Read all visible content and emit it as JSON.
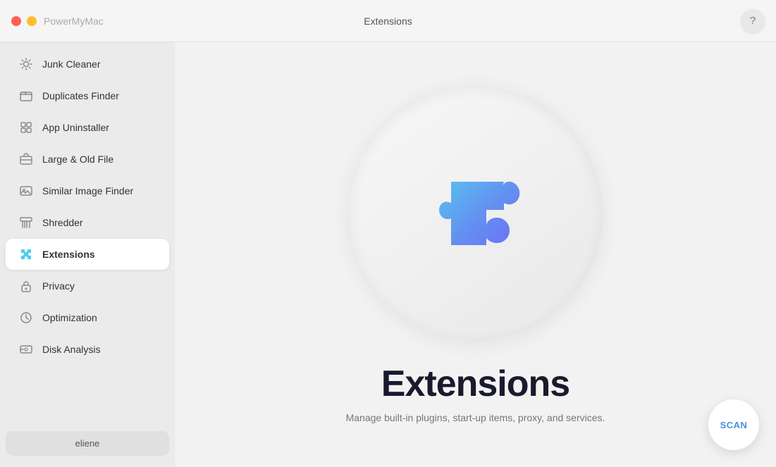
{
  "titleBar": {
    "appName": "PowerMyMac",
    "centerTitle": "Extensions",
    "helpLabel": "?"
  },
  "sidebar": {
    "items": [
      {
        "id": "junk-cleaner",
        "label": "Junk Cleaner",
        "active": false,
        "iconType": "gear"
      },
      {
        "id": "duplicates-finder",
        "label": "Duplicates Finder",
        "active": false,
        "iconType": "folder"
      },
      {
        "id": "app-uninstaller",
        "label": "App Uninstaller",
        "active": false,
        "iconType": "app"
      },
      {
        "id": "large-old-file",
        "label": "Large & Old File",
        "active": false,
        "iconType": "briefcase"
      },
      {
        "id": "similar-image-finder",
        "label": "Similar Image Finder",
        "active": false,
        "iconType": "image"
      },
      {
        "id": "shredder",
        "label": "Shredder",
        "active": false,
        "iconType": "shredder"
      },
      {
        "id": "extensions",
        "label": "Extensions",
        "active": true,
        "iconType": "puzzle"
      },
      {
        "id": "privacy",
        "label": "Privacy",
        "active": false,
        "iconType": "lock"
      },
      {
        "id": "optimization",
        "label": "Optimization",
        "active": false,
        "iconType": "optimization"
      },
      {
        "id": "disk-analysis",
        "label": "Disk Analysis",
        "active": false,
        "iconType": "disk"
      }
    ],
    "user": "eliene"
  },
  "content": {
    "heroTitle": "Extensions",
    "heroSubtitle": "Manage built-in plugins, start-up items, proxy, and services.",
    "scanLabel": "SCAN"
  }
}
